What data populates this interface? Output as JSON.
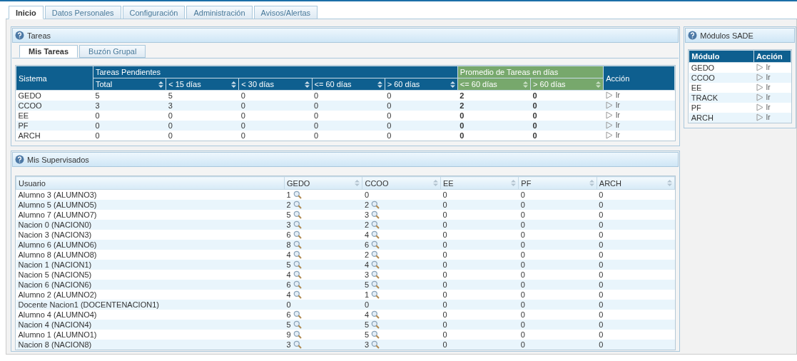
{
  "tabs": [
    {
      "label": "Inicio",
      "selected": true
    },
    {
      "label": "Datos Personales",
      "selected": false
    },
    {
      "label": "Configuración",
      "selected": false
    },
    {
      "label": "Administración",
      "selected": false
    },
    {
      "label": "Avisos/Alertas",
      "selected": false
    }
  ],
  "tareas": {
    "title": "Tareas",
    "subtabs": [
      {
        "label": "Mis Tareas",
        "selected": true
      },
      {
        "label": "Buzón Grupal",
        "selected": false
      }
    ],
    "system_header": "Sistema",
    "pending_header": "Tareas Pendientes",
    "average_header": "Promedio de Tareas en días",
    "action_header": "Acción",
    "pending_columns": [
      "Total",
      "< 15 días",
      "< 30 días",
      "<= 60 días",
      "> 60 días"
    ],
    "average_columns": [
      "<= 60 días",
      "> 60 días"
    ],
    "rows": [
      {
        "system": "GEDO",
        "pending": [
          "5",
          "5",
          "0",
          "0",
          "0"
        ],
        "average": [
          "2",
          "0"
        ],
        "action": "Ir"
      },
      {
        "system": "CCOO",
        "pending": [
          "3",
          "3",
          "0",
          "0",
          "0"
        ],
        "average": [
          "2",
          "0"
        ],
        "action": "Ir"
      },
      {
        "system": "EE",
        "pending": [
          "0",
          "0",
          "0",
          "0",
          "0"
        ],
        "average": [
          "0",
          "0"
        ],
        "action": "Ir"
      },
      {
        "system": "PF",
        "pending": [
          "0",
          "0",
          "0",
          "0",
          "0"
        ],
        "average": [
          "0",
          "0"
        ],
        "action": "Ir"
      },
      {
        "system": "ARCH",
        "pending": [
          "0",
          "0",
          "0",
          "0",
          "0"
        ],
        "average": [
          "0",
          "0"
        ],
        "action": "Ir"
      }
    ]
  },
  "modulos": {
    "title": "Módulos SADE",
    "columns": [
      "Módulo",
      "Acción"
    ],
    "rows": [
      {
        "module": "GEDO",
        "action": "Ir"
      },
      {
        "module": "CCOO",
        "action": "Ir"
      },
      {
        "module": "EE",
        "action": "Ir"
      },
      {
        "module": "TRACK",
        "action": "Ir"
      },
      {
        "module": "PF",
        "action": "Ir"
      },
      {
        "module": "ARCH",
        "action": "Ir"
      }
    ]
  },
  "supervisados": {
    "title": "Mis Supervisados",
    "columns": [
      "Usuario",
      "GEDO",
      "CCOO",
      "EE",
      "PF",
      "ARCH"
    ],
    "rows": [
      {
        "cells": [
          "Alumno 3 (ALUMNO3)",
          "1",
          "0",
          "0",
          "0",
          "0"
        ],
        "has_search": [
          false,
          true,
          false,
          false,
          false,
          false
        ]
      },
      {
        "cells": [
          "Alumno 5 (ALUMNO5)",
          "2",
          "2",
          "0",
          "0",
          "0"
        ],
        "has_search": [
          false,
          true,
          true,
          false,
          false,
          false
        ]
      },
      {
        "cells": [
          "Alumno 7 (ALUMNO7)",
          "5",
          "3",
          "0",
          "0",
          "0"
        ],
        "has_search": [
          false,
          true,
          true,
          false,
          false,
          false
        ]
      },
      {
        "cells": [
          "Nacion 0 (NACION0)",
          "3",
          "2",
          "0",
          "0",
          "0"
        ],
        "has_search": [
          false,
          true,
          true,
          false,
          false,
          false
        ]
      },
      {
        "cells": [
          "Nacion 3 (NACION3)",
          "6",
          "4",
          "0",
          "0",
          "0"
        ],
        "has_search": [
          false,
          true,
          true,
          false,
          false,
          false
        ]
      },
      {
        "cells": [
          "Alumno 6 (ALUMNO6)",
          "8",
          "6",
          "0",
          "0",
          "0"
        ],
        "has_search": [
          false,
          true,
          true,
          false,
          false,
          false
        ]
      },
      {
        "cells": [
          "Alumno 8 (ALUMNO8)",
          "4",
          "2",
          "0",
          "0",
          "0"
        ],
        "has_search": [
          false,
          true,
          true,
          false,
          false,
          false
        ]
      },
      {
        "cells": [
          "Nacion 1 (NACION1)",
          "5",
          "4",
          "0",
          "0",
          "0"
        ],
        "has_search": [
          false,
          true,
          true,
          false,
          false,
          false
        ]
      },
      {
        "cells": [
          "Nacion 5 (NACION5)",
          "4",
          "3",
          "0",
          "0",
          "0"
        ],
        "has_search": [
          false,
          true,
          true,
          false,
          false,
          false
        ]
      },
      {
        "cells": [
          "Nacion 6 (NACION6)",
          "6",
          "5",
          "0",
          "0",
          "0"
        ],
        "has_search": [
          false,
          true,
          true,
          false,
          false,
          false
        ]
      },
      {
        "cells": [
          "Alumno 2 (ALUMNO2)",
          "4",
          "1",
          "0",
          "0",
          "0"
        ],
        "has_search": [
          false,
          true,
          true,
          false,
          false,
          false
        ]
      },
      {
        "cells": [
          "Docente Nacion1 (DOCENTENACION1)",
          "0",
          "0",
          "0",
          "0",
          "0"
        ],
        "has_search": [
          false,
          false,
          false,
          false,
          false,
          false
        ]
      },
      {
        "cells": [
          "Alumno 4 (ALUMNO4)",
          "6",
          "4",
          "0",
          "0",
          "0"
        ],
        "has_search": [
          false,
          true,
          true,
          false,
          false,
          false
        ]
      },
      {
        "cells": [
          "Nacion 4 (NACION4)",
          "5",
          "5",
          "0",
          "0",
          "0"
        ],
        "has_search": [
          false,
          true,
          true,
          false,
          false,
          false
        ]
      },
      {
        "cells": [
          "Alumno 1 (ALUMNO1)",
          "9",
          "5",
          "0",
          "0",
          "0"
        ],
        "has_search": [
          false,
          true,
          true,
          false,
          false,
          false
        ]
      },
      {
        "cells": [
          "Nacion 8 (NACION8)",
          "3",
          "3",
          "0",
          "0",
          "0"
        ],
        "has_search": [
          false,
          true,
          true,
          false,
          false,
          false
        ]
      }
    ]
  }
}
